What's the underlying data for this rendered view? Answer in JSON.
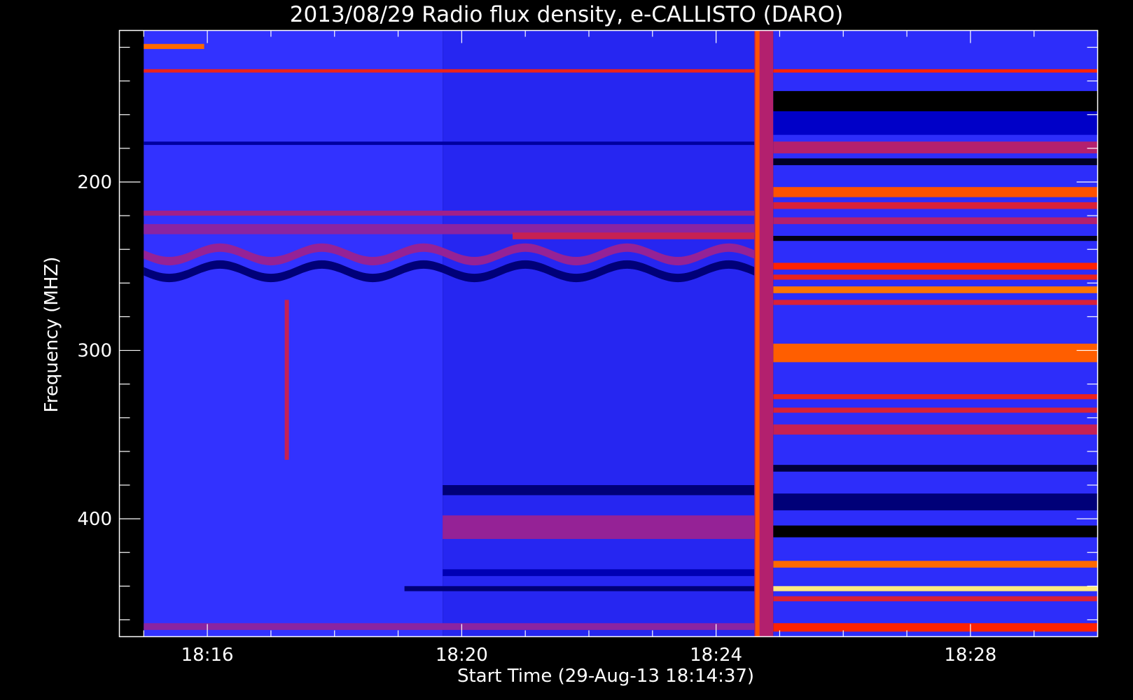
{
  "chart_data": {
    "type": "heatmap",
    "title": "2013/08/29  Radio flux density, e-CALLISTO (DARO)",
    "xlabel": "Start Time (29-Aug-13 18:14:37)",
    "ylabel": "Frequency (MHZ)",
    "x_ticks": [
      "18:16",
      "18:20",
      "18:24",
      "18:28"
    ],
    "x_tick_values_min": [
      16,
      20,
      24,
      28
    ],
    "y_ticks": [
      "200",
      "300",
      "400"
    ],
    "y_tick_values": [
      200,
      300,
      400
    ],
    "xlim_min": [
      14.617,
      30.0
    ],
    "ylim_mhz": [
      470,
      110
    ],
    "data_time_range_min": [
      15.0,
      30.0
    ],
    "data_freq_range_mhz": [
      110,
      470
    ],
    "colormap": [
      "#000000",
      "#0000c8",
      "#3232ff",
      "#a0208a",
      "#ff2200",
      "#ff9900",
      "#ffffa0"
    ],
    "background_color": "#000000",
    "axis_color": "#ffffff",
    "regions": [
      {
        "t_start": 15.0,
        "t_end": 19.7,
        "level": 2.0
      },
      {
        "t_start": 19.7,
        "t_end": 24.6,
        "level": 1.75
      },
      {
        "t_start": 24.6,
        "t_end": 24.9,
        "level": 3.2
      },
      {
        "t_start": 24.9,
        "t_end": 30.0,
        "level": 1.9
      }
    ],
    "bands": [
      {
        "t_start": 15.0,
        "t_end": 15.95,
        "f_low": 118,
        "f_high": 121,
        "level": 4.6
      },
      {
        "t_start": 15.0,
        "t_end": 24.6,
        "f_low": 133,
        "f_high": 135,
        "level": 3.8
      },
      {
        "t_start": 24.9,
        "t_end": 30.0,
        "f_low": 133,
        "f_high": 135,
        "level": 4.0
      },
      {
        "t_start": 24.9,
        "t_end": 30.0,
        "f_low": 146,
        "f_high": 158,
        "level": 0.0
      },
      {
        "t_start": 24.9,
        "t_end": 30.0,
        "f_low": 158,
        "f_high": 172,
        "level": 1.0
      },
      {
        "t_start": 24.9,
        "t_end": 30.0,
        "f_low": 176,
        "f_high": 183,
        "level": 3.2
      },
      {
        "t_start": 24.9,
        "t_end": 30.0,
        "f_low": 186,
        "f_high": 190,
        "level": 0.2
      },
      {
        "t_start": 24.9,
        "t_end": 30.0,
        "f_low": 203,
        "f_high": 209,
        "level": 4.4
      },
      {
        "t_start": 24.9,
        "t_end": 30.0,
        "f_low": 212,
        "f_high": 216,
        "level": 3.6
      },
      {
        "t_start": 24.9,
        "t_end": 30.0,
        "f_low": 221,
        "f_high": 225,
        "level": 3.2
      },
      {
        "t_start": 24.9,
        "t_end": 30.0,
        "f_low": 232,
        "f_high": 235,
        "level": 0.1
      },
      {
        "t_start": 24.9,
        "t_end": 30.0,
        "f_low": 248,
        "f_high": 252,
        "level": 4.0
      },
      {
        "t_start": 24.9,
        "t_end": 30.0,
        "f_low": 255,
        "f_high": 258,
        "level": 3.8
      },
      {
        "t_start": 24.9,
        "t_end": 30.0,
        "f_low": 262,
        "f_high": 266,
        "level": 4.7
      },
      {
        "t_start": 24.9,
        "t_end": 30.0,
        "f_low": 270,
        "f_high": 273,
        "level": 3.6
      },
      {
        "t_start": 24.9,
        "t_end": 30.0,
        "f_low": 296,
        "f_high": 307,
        "level": 4.5
      },
      {
        "t_start": 24.9,
        "t_end": 30.0,
        "f_low": 326,
        "f_high": 329,
        "level": 3.8
      },
      {
        "t_start": 24.9,
        "t_end": 30.0,
        "f_low": 334,
        "f_high": 337,
        "level": 3.6
      },
      {
        "t_start": 24.9,
        "t_end": 30.0,
        "f_low": 344,
        "f_high": 350,
        "level": 3.4
      },
      {
        "t_start": 24.9,
        "t_end": 30.0,
        "f_low": 368,
        "f_high": 372,
        "level": 0.3
      },
      {
        "t_start": 24.9,
        "t_end": 30.0,
        "f_low": 385,
        "f_high": 395,
        "level": 0.6
      },
      {
        "t_start": 24.9,
        "t_end": 30.0,
        "f_low": 404,
        "f_high": 411,
        "level": 0.0
      },
      {
        "t_start": 24.9,
        "t_end": 30.0,
        "f_low": 425,
        "f_high": 429,
        "level": 4.6
      },
      {
        "t_start": 24.9,
        "t_end": 30.0,
        "f_low": 440,
        "f_high": 443,
        "level": 5.8
      },
      {
        "t_start": 24.9,
        "t_end": 30.0,
        "f_low": 446,
        "f_high": 449,
        "level": 3.6
      },
      {
        "t_start": 19.7,
        "t_end": 24.6,
        "f_low": 380,
        "f_high": 386,
        "level": 0.6
      },
      {
        "t_start": 19.7,
        "t_end": 24.6,
        "f_low": 398,
        "f_high": 412,
        "level": 2.9
      },
      {
        "t_start": 19.7,
        "t_end": 24.6,
        "f_low": 430,
        "f_high": 434,
        "level": 0.9
      },
      {
        "t_start": 19.1,
        "t_end": 24.6,
        "f_low": 440,
        "f_high": 443,
        "level": 0.6
      },
      {
        "t_start": 15.0,
        "t_end": 24.6,
        "f_low": 176,
        "f_high": 178,
        "level": 0.8
      },
      {
        "t_start": 15.0,
        "t_end": 24.6,
        "f_low": 217,
        "f_high": 220,
        "level": 3.0
      },
      {
        "t_start": 15.0,
        "t_end": 24.6,
        "f_low": 225,
        "f_high": 231,
        "level": 2.8
      },
      {
        "t_start": 20.8,
        "t_end": 24.6,
        "f_low": 230,
        "f_high": 234,
        "level": 3.4
      },
      {
        "t_start": 15.0,
        "t_end": 24.6,
        "f_low": 462,
        "f_high": 466,
        "level": 2.8
      },
      {
        "t_start": 24.9,
        "t_end": 30.0,
        "f_low": 462,
        "f_high": 467,
        "level": 4.0
      }
    ],
    "wave_bands": [
      {
        "t_start": 15.0,
        "t_end": 24.6,
        "f_center": 253,
        "amplitude_mhz": 4,
        "period_min": 1.6,
        "width_mhz": 5,
        "level": 0.6
      },
      {
        "t_start": 15.0,
        "t_end": 24.6,
        "f_center": 243,
        "amplitude_mhz": 4,
        "period_min": 1.6,
        "width_mhz": 5,
        "level": 2.9
      }
    ],
    "bursts": [
      {
        "t": 24.65,
        "f_low": 110,
        "f_high": 470,
        "level": 4.4
      },
      {
        "t": 17.25,
        "f_low": 270,
        "f_high": 365,
        "level": 3.4
      }
    ]
  }
}
